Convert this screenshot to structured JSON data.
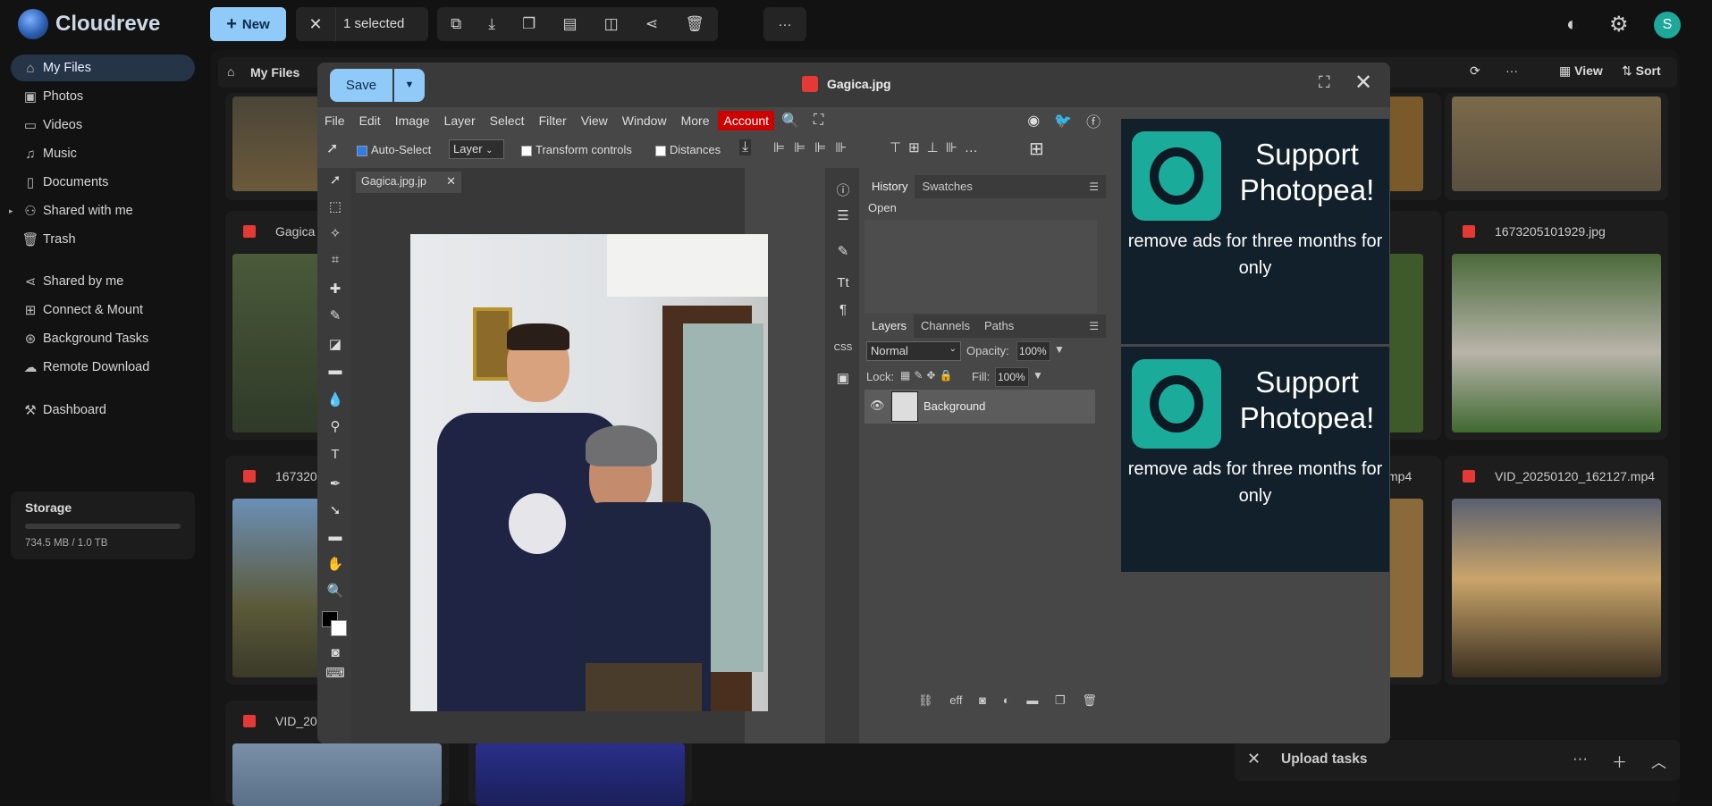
{
  "app": {
    "name": "Cloudreve"
  },
  "topbar": {
    "new_label": "New",
    "selection_label": "1 selected",
    "actions": [
      "open-external",
      "download",
      "copy",
      "move",
      "compare",
      "share",
      "delete"
    ],
    "user_initial": "S"
  },
  "sidebar": {
    "items": [
      {
        "label": "My Files",
        "icon": "home-icon"
      },
      {
        "label": "Photos",
        "icon": "image-icon"
      },
      {
        "label": "Videos",
        "icon": "video-icon"
      },
      {
        "label": "Music",
        "icon": "music-icon"
      },
      {
        "label": "Documents",
        "icon": "document-icon"
      },
      {
        "label": "Shared with me",
        "icon": "people-icon"
      },
      {
        "label": "Trash",
        "icon": "trash-icon"
      },
      {
        "label": "Shared by me",
        "icon": "share-icon"
      },
      {
        "label": "Connect & Mount",
        "icon": "link-icon"
      },
      {
        "label": "Background Tasks",
        "icon": "tasks-icon"
      },
      {
        "label": "Remote Download",
        "icon": "cloud-download-icon"
      },
      {
        "label": "Dashboard",
        "icon": "dashboard-icon"
      }
    ],
    "storage": {
      "title": "Storage",
      "usage": "734.5 MB / 1.0 TB",
      "used_fraction": 0.0007
    }
  },
  "breadcrumb": {
    "current": "My Files",
    "view_label": "View",
    "sort_label": "Sort"
  },
  "files": {
    "visible_names": [
      "Gagica",
      "1673205101929.jpg",
      "167320",
      "mp4",
      "VID_20250120_162127.mp4",
      "VID_20"
    ]
  },
  "modal": {
    "title": "Gagica.jpg",
    "save_label": "Save"
  },
  "photopea": {
    "menu": [
      "File",
      "Edit",
      "Image",
      "Layer",
      "Select",
      "Filter",
      "View",
      "Window",
      "More"
    ],
    "account_label": "Account",
    "options": {
      "auto_select_label": "Auto-Select",
      "auto_select_checked": true,
      "layer_select_value": "Layer",
      "transform_label": "Transform controls",
      "distances_label": "Distances"
    },
    "doc_tab": "Gagica.jpg.jp",
    "history_panel": {
      "tabs": [
        "History",
        "Swatches"
      ],
      "entries": [
        "Open"
      ]
    },
    "layers_panel": {
      "tabs": [
        "Layers",
        "Channels",
        "Paths"
      ],
      "blend_mode": "Normal",
      "opacity_label": "Opacity:",
      "opacity_value": "100%",
      "lock_label": "Lock:",
      "fill_label": "Fill:",
      "fill_value": "100%",
      "layers": [
        {
          "name": "Background"
        }
      ]
    },
    "ads": [
      {
        "heading": "Support Photopea!",
        "body": "remove ads for three months for only"
      },
      {
        "heading": "Support Photopea!",
        "body": "remove ads for three months for only"
      }
    ]
  },
  "upload": {
    "label": "Upload tasks"
  },
  "colors": {
    "accent": "#90caf9",
    "brand_teal": "#1aab9b",
    "account_red": "#cc0000"
  }
}
